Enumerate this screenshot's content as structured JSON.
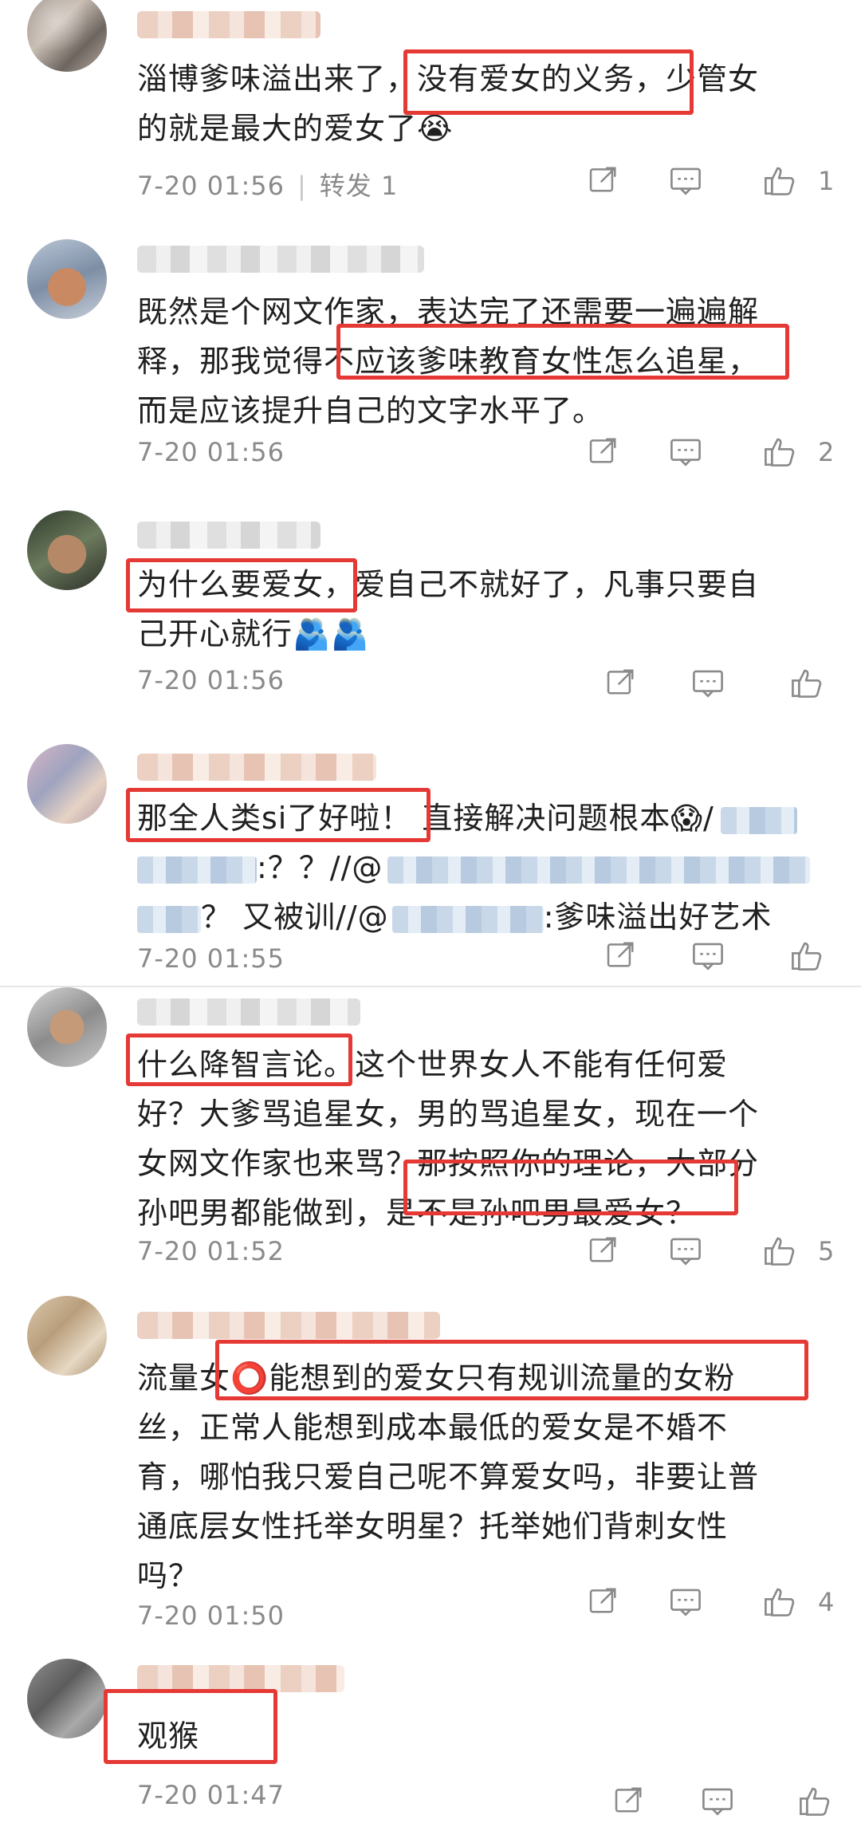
{
  "comments": [
    {
      "lines": [
        "淄博爹味溢出来了，没有爱女的义务，少管女",
        "的就是最大的爱女了😭"
      ],
      "time": "7-20 01:56",
      "repost": "转发 1",
      "likes": "1"
    },
    {
      "lines": [
        "既然是个网文作家，表达完了还需要一遍遍解",
        "释，那我觉得不应该爹味教育女性怎么追星，",
        "而是应该提升自己的文字水平了。"
      ],
      "time": "7-20 01:56",
      "likes": "2"
    },
    {
      "lines": [
        "为什么要爱女，爱自己不就好了，凡事只要自",
        "己开心就行🫂🫂"
      ],
      "time": "7-20 01:56",
      "likes": ""
    },
    {
      "lines_a": [
        "那全人类si了好啦！ 直接解决问题根本😱/"
      ],
      "line2_tail": ":？？//@",
      "line3_mid": "？ 又被训//@",
      "line3_tail": ":爹味溢出好艺术",
      "time": "7-20 01:55",
      "likes": ""
    },
    {
      "lines": [
        "什么降智言论。这个世界女人不能有任何爱",
        "好？大爹骂追星女，男的骂追星女，现在一个",
        "女网文作家也来骂？那按照你的理论，大部分",
        "孙吧男都能做到，是不是孙吧男最爱女？"
      ],
      "time": "7-20 01:52",
      "likes": "5"
    },
    {
      "lines": [
        "流量女⭕能想到的爱女只有规训流量的女粉",
        "丝，正常人能想到成本最低的爱女是不婚不",
        "育，哪怕我只爱自己呢不算爱女吗，非要让普",
        "通底层女性托举女明星？托举她们背刺女性",
        "吗？"
      ],
      "time": "7-20 01:50",
      "likes": "4"
    },
    {
      "lines": [
        "观猴"
      ],
      "time": "7-20 01:47",
      "likes": ""
    }
  ],
  "icons": {
    "share": "share-icon",
    "comment": "comment-icon",
    "like": "thumbs-up-icon"
  },
  "colors": {
    "highlight": "#e53935",
    "meta": "#8a8a8a"
  }
}
